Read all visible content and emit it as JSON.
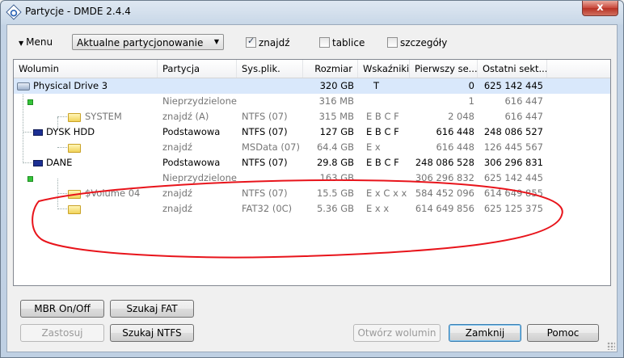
{
  "window": {
    "title": "Partycje - DMDE 2.4.4",
    "close_glyph": "x"
  },
  "toolbar": {
    "menu_label": "Menu",
    "mode_select": "Aktualne partycjonowanie",
    "checkboxes": [
      {
        "label": "znajdź",
        "checked": true
      },
      {
        "label": "tablice",
        "checked": false
      },
      {
        "label": "szczegóły",
        "checked": false
      }
    ]
  },
  "table": {
    "columns": [
      "Wolumin",
      "Partycja",
      "Sys.plik.",
      "Rozmiar",
      "Wskaźniki",
      "Pierwszy se...",
      "Ostatni sekt..."
    ],
    "rows": [
      {
        "wolumin": "Physical Drive 3",
        "partycja": "",
        "sys": "",
        "rozmiar": "320 GB",
        "wskazniki": "T",
        "pierwszy": "0",
        "ostatni": "625 142 445"
      },
      {
        "wolumin": "",
        "partycja": "Nieprzydzielone",
        "sys": "",
        "rozmiar": "316 MB",
        "wskazniki": "",
        "pierwszy": "1",
        "ostatni": "616 447"
      },
      {
        "wolumin": "SYSTEM",
        "partycja": "znajdź (A)",
        "sys": "NTFS (07)",
        "rozmiar": "315 MB",
        "wskazniki": "E B C F",
        "pierwszy": "2 048",
        "ostatni": "616 447"
      },
      {
        "wolumin": "DYSK HDD",
        "partycja": "Podstawowa",
        "sys": "NTFS (07)",
        "rozmiar": "127 GB",
        "wskazniki": "E B C F",
        "pierwszy": "616 448",
        "ostatni": "248 086 527"
      },
      {
        "wolumin": "",
        "partycja": "znajdź",
        "sys": "MSData (07)",
        "rozmiar": "64.4 GB",
        "wskazniki": "E x",
        "pierwszy": "616 448",
        "ostatni": "126 445 567"
      },
      {
        "wolumin": "DANE",
        "partycja": "Podstawowa",
        "sys": "NTFS (07)",
        "rozmiar": "29.8 GB",
        "wskazniki": "E B C F",
        "pierwszy": "248 086 528",
        "ostatni": "306 296 831"
      },
      {
        "wolumin": "",
        "partycja": "Nieprzydzielone",
        "sys": "",
        "rozmiar": "163 GB",
        "wskazniki": "",
        "pierwszy": "306 296 832",
        "ostatni": "625 142 445"
      },
      {
        "wolumin": "$Volume 04",
        "partycja": "znajdź",
        "sys": "NTFS (07)",
        "rozmiar": "15.5 GB",
        "wskazniki": "E x C x x",
        "pierwszy": "584 452 096",
        "ostatni": "614 649 855"
      },
      {
        "wolumin": "",
        "partycja": "znajdź",
        "sys": "FAT32 (0C)",
        "rozmiar": "5.36 GB",
        "wskazniki": "E x x",
        "pierwszy": "614 649 856",
        "ostatni": "625 125 375"
      }
    ]
  },
  "annotation_color": "#e8141b",
  "buttons": {
    "mbr": "MBR On/Off",
    "szukaj_fat": "Szukaj FAT",
    "zastosuj": "Zastosuj",
    "szukaj_ntfs": "Szukaj NTFS",
    "otworz": "Otwórz wolumin",
    "zamknij": "Zamknij",
    "pomoc": "Pomoc"
  }
}
